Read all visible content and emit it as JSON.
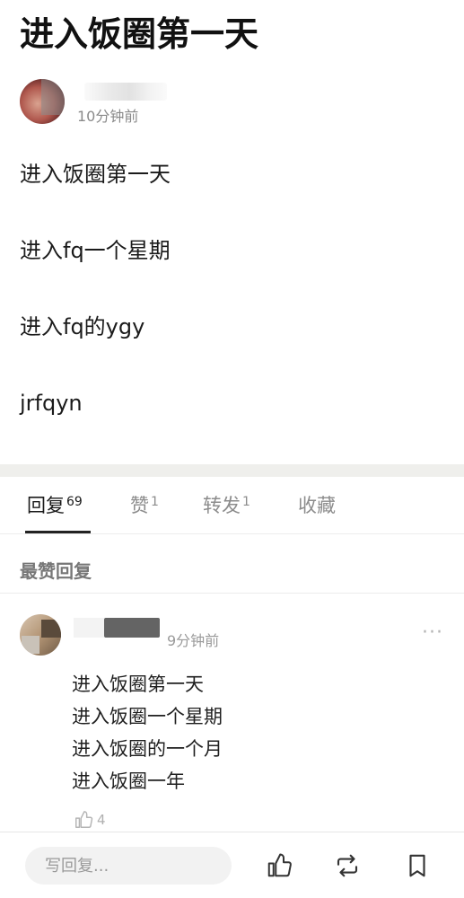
{
  "post": {
    "title": "进入饭圈第一天",
    "time": "10分钟前",
    "lines": [
      "进入饭圈第一天",
      "进入fq一个星期",
      "进入fq的ygy",
      "jrfqyn"
    ]
  },
  "tabs": [
    {
      "label": "回复",
      "count": "69"
    },
    {
      "label": "赞",
      "count": "1"
    },
    {
      "label": "转发",
      "count": "1"
    },
    {
      "label": "收藏",
      "count": ""
    }
  ],
  "comments_section": {
    "label": "最赞回复",
    "comment": {
      "time": "9分钟前",
      "more": "···",
      "lines": [
        "进入饭圈第一天",
        "进入饭圈一个星期",
        "进入饭圈的一个月",
        "进入饭圈一年"
      ],
      "likes": "4"
    }
  },
  "bottom_bar": {
    "reply_placeholder": "写回复...",
    "icons": [
      "thumbs-up-icon",
      "repost-icon",
      "bookmark-icon"
    ]
  }
}
